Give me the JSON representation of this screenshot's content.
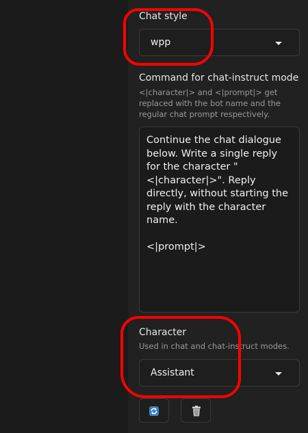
{
  "chat_style": {
    "label": "Chat style",
    "selected": "wpp"
  },
  "command": {
    "label": "Command for chat-instruct mode",
    "info": "<|character|> and <|prompt|> get replaced with the bot name and the regular chat prompt respectively.",
    "value": "Continue the chat dialogue below. Write a single reply for the character \"<|character|>\". Reply directly, without starting the reply with the character name.\n\n<|prompt|>"
  },
  "character": {
    "label": "Character",
    "info": "Used in chat and chat-instruct modes.",
    "selected": "Assistant"
  },
  "buttons": {
    "refresh_icon": "refresh-icon",
    "delete_icon": "trash-icon"
  },
  "colors": {
    "panel": "#212121",
    "highlight": "#ff0000",
    "refresh": "#3b82c4"
  }
}
